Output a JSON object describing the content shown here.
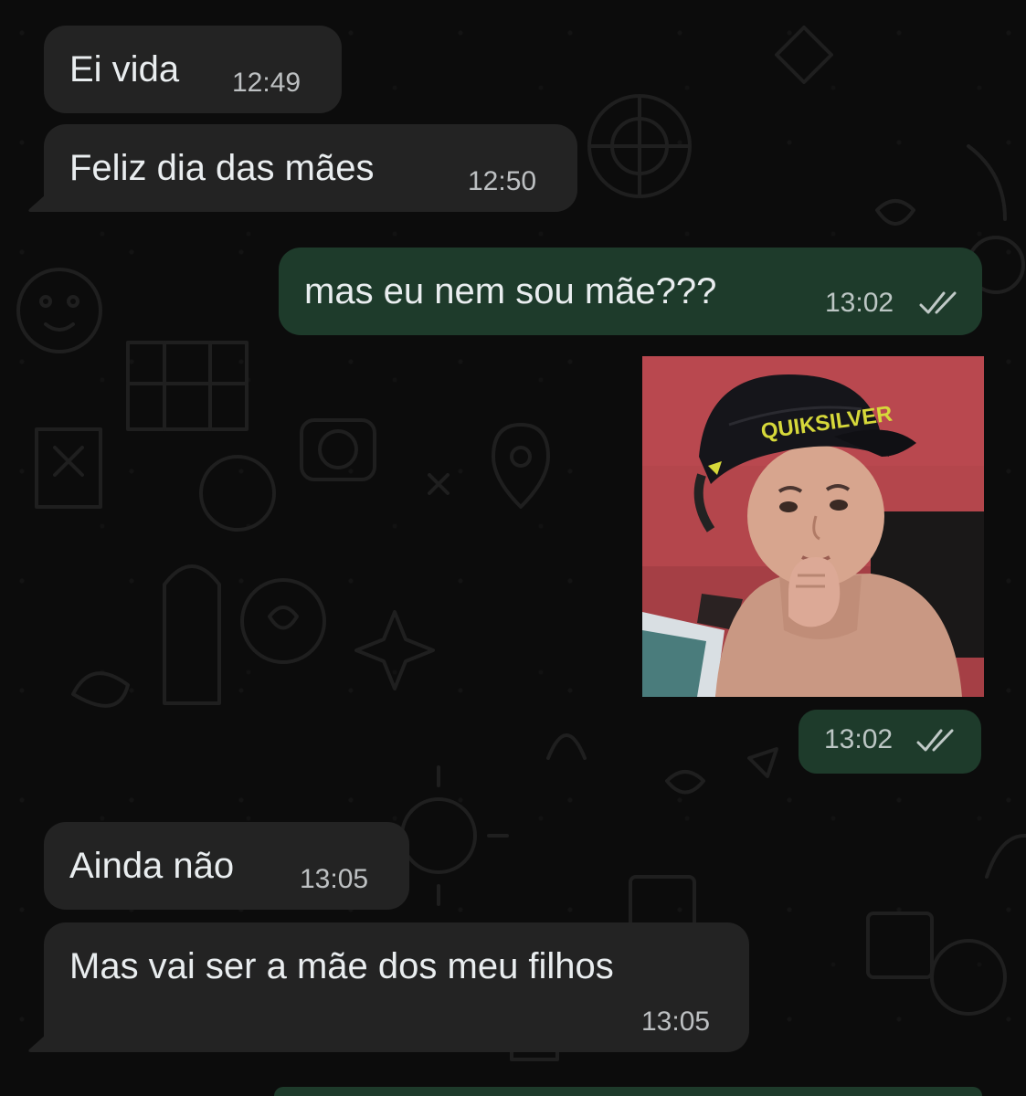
{
  "messages": [
    {
      "direction": "incoming",
      "text": "Ei vida",
      "time": "12:49"
    },
    {
      "direction": "incoming",
      "text": "Feliz dia das mães",
      "time": "12:50"
    },
    {
      "direction": "outgoing",
      "text": "mas eu nem sou mãe???",
      "time": "13:02",
      "status": "read-double-check"
    },
    {
      "direction": "outgoing",
      "type": "image",
      "image_logo": "QUIKSILVER",
      "time": "13:02",
      "status": "read-double-check"
    },
    {
      "direction": "incoming",
      "text": "Ainda não",
      "time": "13:05"
    },
    {
      "direction": "incoming",
      "text": "Mas vai ser a mãe dos meu filhos",
      "time": "13:05"
    }
  ],
  "colors": {
    "background": "#0c0c0c",
    "incoming_bubble": "#232323",
    "outgoing_bubble": "#1e3b2b",
    "text": "#e9edef"
  }
}
